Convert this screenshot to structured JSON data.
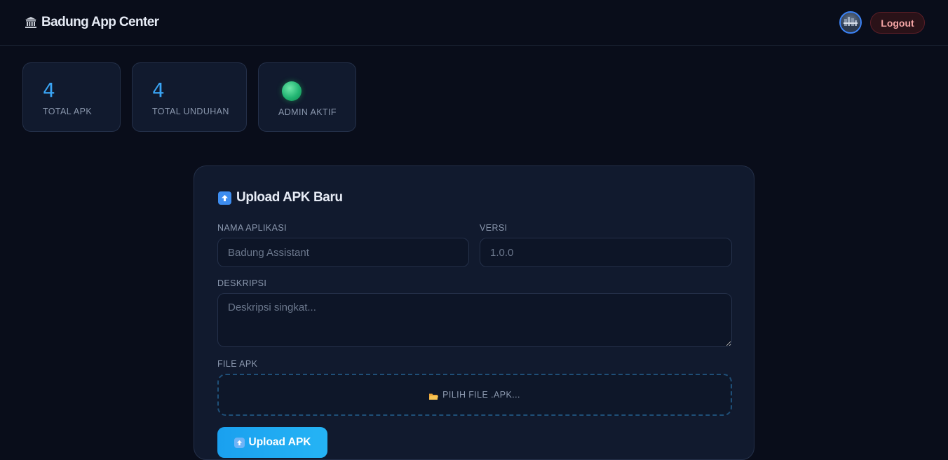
{
  "header": {
    "brand_icon": "bank-building-icon",
    "title": "Badung App Center",
    "avatar_icon": "user-avatar",
    "logout_label": "Logout"
  },
  "stats": [
    {
      "value": "4",
      "label": "TOTAL APK"
    },
    {
      "value": "4",
      "label": "TOTAL UNDUHAN"
    },
    {
      "indicator": "green-status-dot",
      "label": "ADMIN AKTIF"
    }
  ],
  "upload_form": {
    "title_icon": "up-arrow-icon",
    "title": "Upload APK Baru",
    "name_label": "NAMA APLIKASI",
    "name_placeholder": "Badung Assistant",
    "version_label": "VERSI",
    "version_placeholder": "1.0.0",
    "description_label": "DESKRIPSI",
    "description_placeholder": "Deskripsi singkat...",
    "file_label": "FILE APK",
    "file_icon": "folder-icon",
    "file_prompt": "PILIH FILE .APK...",
    "submit_label": "Upload APK"
  },
  "colors": {
    "background": "#090d1a",
    "card": "#111a2e",
    "accent": "#3aa5f5",
    "status_active": "#22b573",
    "logout_text": "#f5a5a5"
  }
}
